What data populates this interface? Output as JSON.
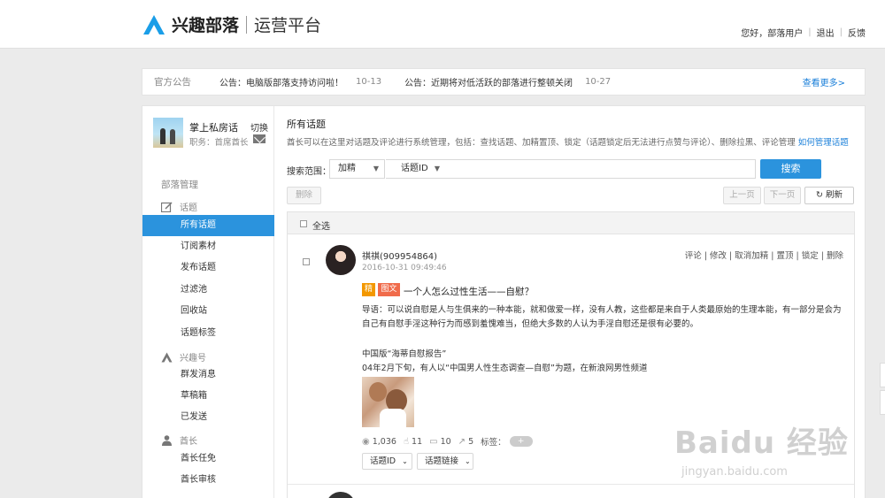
{
  "header": {
    "brand": "兴趣部落",
    "subtitle": "运营平台",
    "greeting": "您好，部落用户",
    "logout": "退出",
    "feedback": "反馈"
  },
  "notice": {
    "label": "官方公告",
    "items": [
      {
        "text": "公告：电脑版部落支持访问啦！",
        "date": "10-13"
      },
      {
        "text": "公告：近期将对低活跃的部落进行整顿关闭",
        "date": "10-27"
      }
    ],
    "more": "查看更多>"
  },
  "profile": {
    "name": "掌上私房话",
    "switch": "切换",
    "role": "职务：首席酋长"
  },
  "sidebar": {
    "group_title": "部落管理",
    "sections": [
      {
        "label": "话题",
        "icon": "edit-icon"
      },
      {
        "label": "兴趣号",
        "icon": "tribe-icon"
      },
      {
        "label": "酋长",
        "icon": "person-icon"
      }
    ],
    "topic_items": [
      "所有话题",
      "订阅素材",
      "发布话题",
      "过滤池",
      "回收站",
      "话题标签"
    ],
    "interest_items": [
      "群发消息",
      "草稿箱",
      "已发送"
    ],
    "chief_items": [
      "酋长任免",
      "酋长审核"
    ]
  },
  "content": {
    "title": "所有话题",
    "description": "酋长可以在这里对话题及评论进行系统管理，包括：查找话题、加精置顶、锁定（话题锁定后无法进行点赞与评论）、删除拉黑、评论管理 ",
    "description_link": "如何管理话题",
    "search_label": "搜索范围：",
    "scope_select": "加精",
    "field_select": "话题ID",
    "search_input_value": "",
    "search_button": "搜索",
    "delete_button": "删除",
    "prev_button": "上一页",
    "next_button": "下一页",
    "refresh_button": "刷新",
    "select_all": "全选"
  },
  "post": {
    "author": "祺祺(909954864)",
    "time": "2016-10-31 09:49:46",
    "actions": "评论 | 修改 | 取消加精 | 置顶 | 锁定 | 删除",
    "tag_featured": "精",
    "tag_type": "图文",
    "title": "一个人怎么过性生活——自慰？",
    "excerpt": "导语：可以说自慰是人与生俱来的一种本能，就和做爱一样，没有人教，这些都是来自于人类最原始的生理本能，有一部分是会为自己有自慰手淫这种行为而感到羞愧难当，但绝大多数的人认为手淫自慰还是很有必要的。",
    "para1": "中国版“海蒂自慰报告”",
    "para2": "04年2月下旬，有人以“中国男人性生态调查—自慰”为题，在新浪网男性频道",
    "views": "1,036",
    "likes": "11",
    "comments": "10",
    "shares": "5",
    "tags_label": "标签：",
    "tag_add": "+",
    "dropdown1": "话题ID",
    "dropdown2": "话题链接"
  },
  "watermark": {
    "logo": "Baidu 经验",
    "url": "jingyan.baidu.com"
  },
  "colors": {
    "accent": "#2b93dd",
    "link": "#1a7fd9",
    "tag_featured": "#f39800",
    "tag_type": "#f06b4b",
    "brand_logo": "#1a9ee8"
  }
}
